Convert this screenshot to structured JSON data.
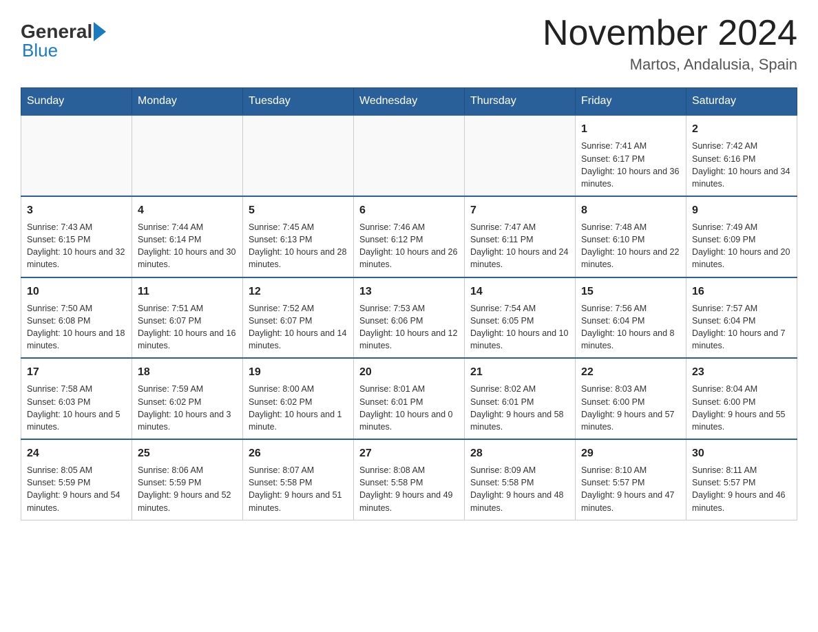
{
  "header": {
    "title": "November 2024",
    "location": "Martos, Andalusia, Spain",
    "logo_general": "General",
    "logo_blue": "Blue"
  },
  "weekdays": [
    "Sunday",
    "Monday",
    "Tuesday",
    "Wednesday",
    "Thursday",
    "Friday",
    "Saturday"
  ],
  "weeks": [
    [
      {
        "day": "",
        "info": ""
      },
      {
        "day": "",
        "info": ""
      },
      {
        "day": "",
        "info": ""
      },
      {
        "day": "",
        "info": ""
      },
      {
        "day": "",
        "info": ""
      },
      {
        "day": "1",
        "info": "Sunrise: 7:41 AM\nSunset: 6:17 PM\nDaylight: 10 hours and 36 minutes."
      },
      {
        "day": "2",
        "info": "Sunrise: 7:42 AM\nSunset: 6:16 PM\nDaylight: 10 hours and 34 minutes."
      }
    ],
    [
      {
        "day": "3",
        "info": "Sunrise: 7:43 AM\nSunset: 6:15 PM\nDaylight: 10 hours and 32 minutes."
      },
      {
        "day": "4",
        "info": "Sunrise: 7:44 AM\nSunset: 6:14 PM\nDaylight: 10 hours and 30 minutes."
      },
      {
        "day": "5",
        "info": "Sunrise: 7:45 AM\nSunset: 6:13 PM\nDaylight: 10 hours and 28 minutes."
      },
      {
        "day": "6",
        "info": "Sunrise: 7:46 AM\nSunset: 6:12 PM\nDaylight: 10 hours and 26 minutes."
      },
      {
        "day": "7",
        "info": "Sunrise: 7:47 AM\nSunset: 6:11 PM\nDaylight: 10 hours and 24 minutes."
      },
      {
        "day": "8",
        "info": "Sunrise: 7:48 AM\nSunset: 6:10 PM\nDaylight: 10 hours and 22 minutes."
      },
      {
        "day": "9",
        "info": "Sunrise: 7:49 AM\nSunset: 6:09 PM\nDaylight: 10 hours and 20 minutes."
      }
    ],
    [
      {
        "day": "10",
        "info": "Sunrise: 7:50 AM\nSunset: 6:08 PM\nDaylight: 10 hours and 18 minutes."
      },
      {
        "day": "11",
        "info": "Sunrise: 7:51 AM\nSunset: 6:07 PM\nDaylight: 10 hours and 16 minutes."
      },
      {
        "day": "12",
        "info": "Sunrise: 7:52 AM\nSunset: 6:07 PM\nDaylight: 10 hours and 14 minutes."
      },
      {
        "day": "13",
        "info": "Sunrise: 7:53 AM\nSunset: 6:06 PM\nDaylight: 10 hours and 12 minutes."
      },
      {
        "day": "14",
        "info": "Sunrise: 7:54 AM\nSunset: 6:05 PM\nDaylight: 10 hours and 10 minutes."
      },
      {
        "day": "15",
        "info": "Sunrise: 7:56 AM\nSunset: 6:04 PM\nDaylight: 10 hours and 8 minutes."
      },
      {
        "day": "16",
        "info": "Sunrise: 7:57 AM\nSunset: 6:04 PM\nDaylight: 10 hours and 7 minutes."
      }
    ],
    [
      {
        "day": "17",
        "info": "Sunrise: 7:58 AM\nSunset: 6:03 PM\nDaylight: 10 hours and 5 minutes."
      },
      {
        "day": "18",
        "info": "Sunrise: 7:59 AM\nSunset: 6:02 PM\nDaylight: 10 hours and 3 minutes."
      },
      {
        "day": "19",
        "info": "Sunrise: 8:00 AM\nSunset: 6:02 PM\nDaylight: 10 hours and 1 minute."
      },
      {
        "day": "20",
        "info": "Sunrise: 8:01 AM\nSunset: 6:01 PM\nDaylight: 10 hours and 0 minutes."
      },
      {
        "day": "21",
        "info": "Sunrise: 8:02 AM\nSunset: 6:01 PM\nDaylight: 9 hours and 58 minutes."
      },
      {
        "day": "22",
        "info": "Sunrise: 8:03 AM\nSunset: 6:00 PM\nDaylight: 9 hours and 57 minutes."
      },
      {
        "day": "23",
        "info": "Sunrise: 8:04 AM\nSunset: 6:00 PM\nDaylight: 9 hours and 55 minutes."
      }
    ],
    [
      {
        "day": "24",
        "info": "Sunrise: 8:05 AM\nSunset: 5:59 PM\nDaylight: 9 hours and 54 minutes."
      },
      {
        "day": "25",
        "info": "Sunrise: 8:06 AM\nSunset: 5:59 PM\nDaylight: 9 hours and 52 minutes."
      },
      {
        "day": "26",
        "info": "Sunrise: 8:07 AM\nSunset: 5:58 PM\nDaylight: 9 hours and 51 minutes."
      },
      {
        "day": "27",
        "info": "Sunrise: 8:08 AM\nSunset: 5:58 PM\nDaylight: 9 hours and 49 minutes."
      },
      {
        "day": "28",
        "info": "Sunrise: 8:09 AM\nSunset: 5:58 PM\nDaylight: 9 hours and 48 minutes."
      },
      {
        "day": "29",
        "info": "Sunrise: 8:10 AM\nSunset: 5:57 PM\nDaylight: 9 hours and 47 minutes."
      },
      {
        "day": "30",
        "info": "Sunrise: 8:11 AM\nSunset: 5:57 PM\nDaylight: 9 hours and 46 minutes."
      }
    ]
  ]
}
